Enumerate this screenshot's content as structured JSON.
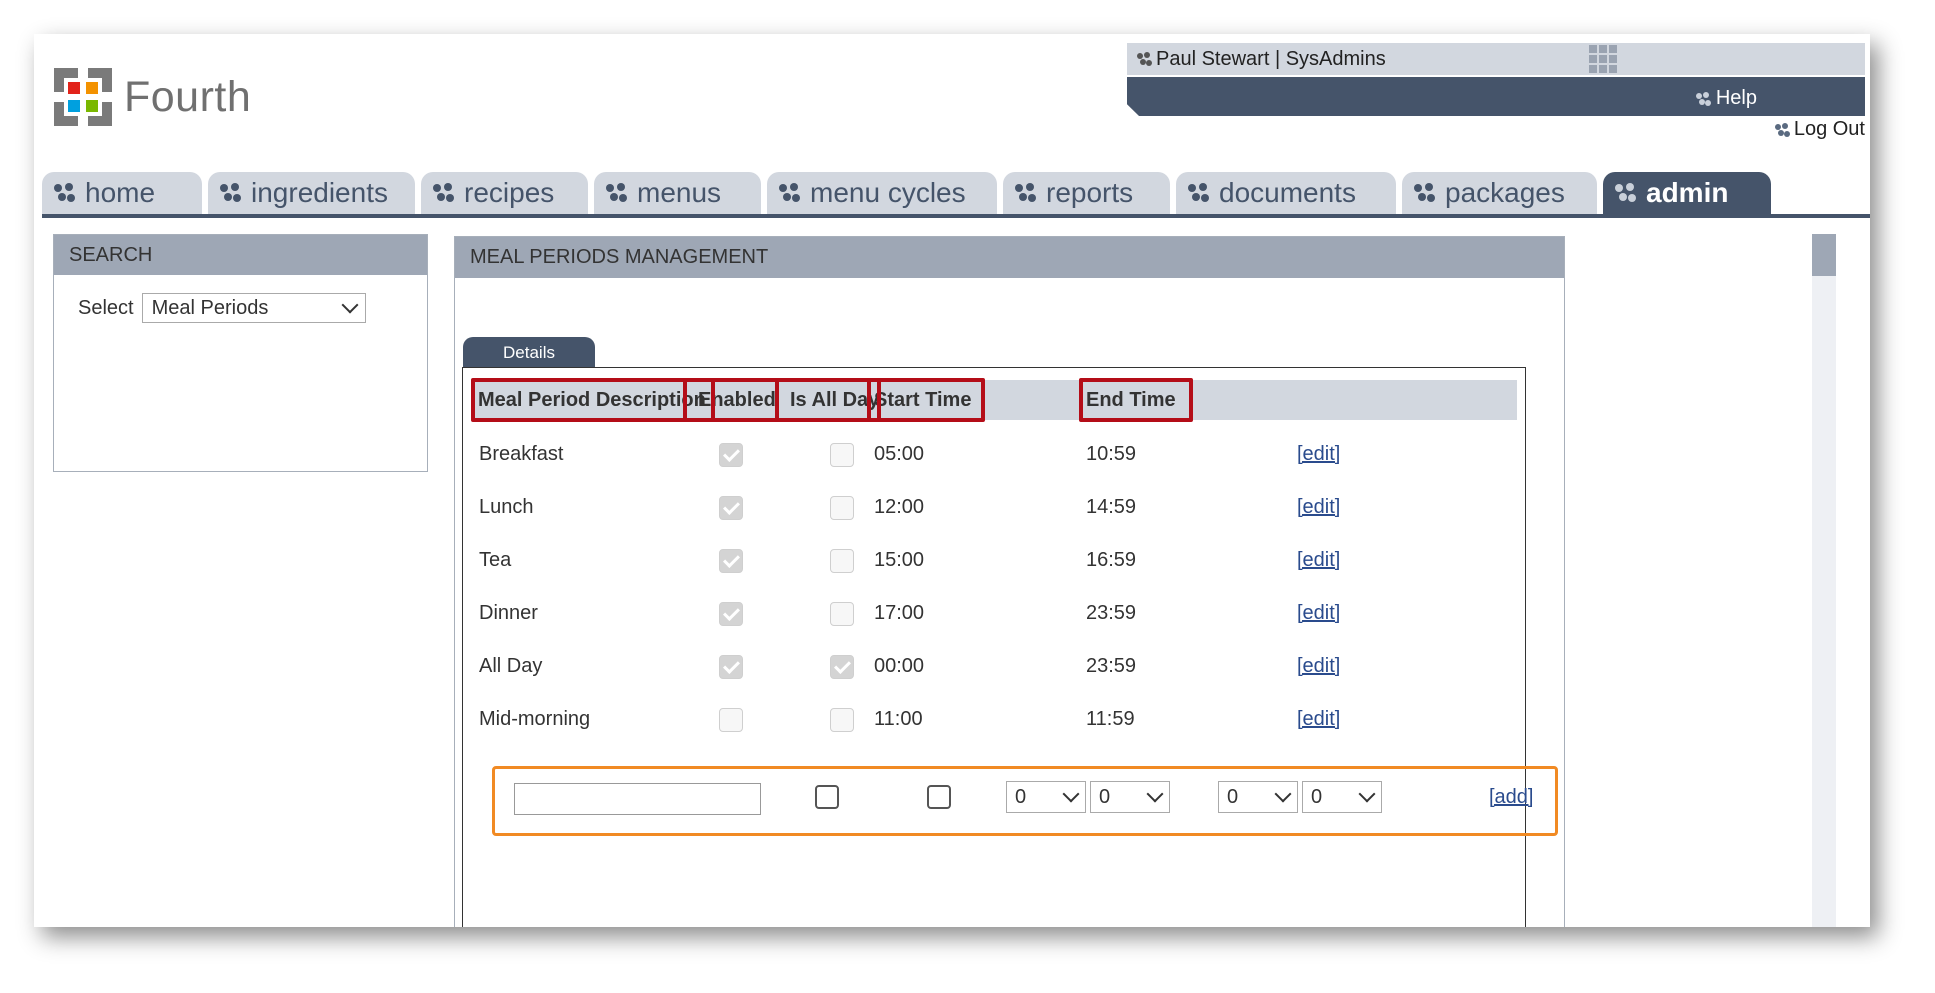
{
  "logo": {
    "text": "Fourth",
    "tm": "·"
  },
  "user": {
    "label": "Paul Stewart | SysAdmins"
  },
  "help": {
    "label": "Help"
  },
  "logout": {
    "label": "Log Out"
  },
  "tabs": [
    {
      "label": "home"
    },
    {
      "label": "ingredients"
    },
    {
      "label": "recipes"
    },
    {
      "label": "menus"
    },
    {
      "label": "menu cycles"
    },
    {
      "label": "reports"
    },
    {
      "label": "documents"
    },
    {
      "label": "packages"
    },
    {
      "label": "admin",
      "active": true
    }
  ],
  "search": {
    "title": "SEARCH",
    "select_label": "Select",
    "selected": "Meal Periods"
  },
  "main": {
    "title": "MEAL PERIODS MANAGEMENT",
    "details_tab": "Details",
    "columns": [
      "Meal Period Description",
      "Enabled",
      "Is All Day",
      "Start Time",
      "End Time"
    ],
    "rows": [
      {
        "name": "Breakfast",
        "enabled": true,
        "all_day": false,
        "start": "05:00",
        "end": "10:59",
        "action": "[edit]"
      },
      {
        "name": "Lunch",
        "enabled": true,
        "all_day": false,
        "start": "12:00",
        "end": "14:59",
        "action": "[edit]"
      },
      {
        "name": "Tea",
        "enabled": true,
        "all_day": false,
        "start": "15:00",
        "end": "16:59",
        "action": "[edit]"
      },
      {
        "name": "Dinner",
        "enabled": true,
        "all_day": false,
        "start": "17:00",
        "end": "23:59",
        "action": "[edit]"
      },
      {
        "name": "All Day",
        "enabled": true,
        "all_day": true,
        "start": "00:00",
        "end": "23:59",
        "action": "[edit]"
      },
      {
        "name": "Mid-morning",
        "enabled": false,
        "all_day": false,
        "start": "11:00",
        "end": "11:59",
        "action": "[edit]"
      }
    ],
    "add_row": {
      "start_hour": "0",
      "start_min": "0",
      "end_hour": "0",
      "end_min": "0",
      "action": "[add]"
    }
  },
  "colors": {
    "nav_dark": "#45546a",
    "nav_light": "#d2d7df",
    "panel_head": "#9ea7b5",
    "highlight_red": "#b40d18",
    "highlight_orange": "#f18a23",
    "link": "#2a4b8d"
  }
}
